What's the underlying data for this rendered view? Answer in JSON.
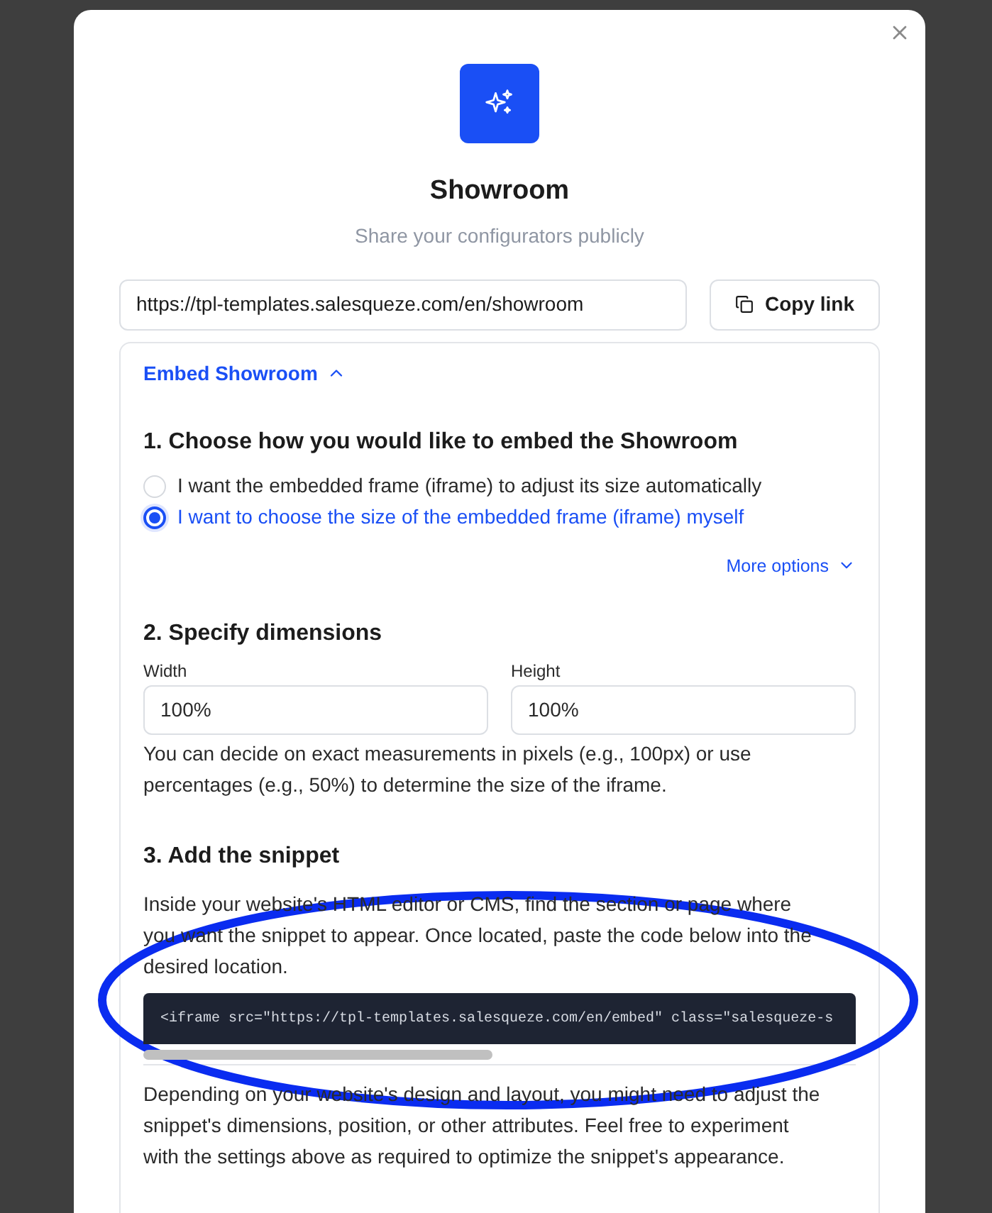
{
  "dialog": {
    "title": "Showroom",
    "subtitle": "Share your configurators publicly",
    "share": {
      "url": "https://tpl-templates.salesqueze.com/en/showroom",
      "copy_button": "Copy link"
    },
    "embed": {
      "header": "Embed Showroom",
      "expanded": true,
      "step1": {
        "heading": "1. Choose how you would like to embed the Showroom",
        "options": [
          {
            "label": "I want the embedded frame (iframe) to adjust its size automatically",
            "selected": false
          },
          {
            "label": "I want to choose the size of the embedded frame (iframe) myself",
            "selected": true
          }
        ],
        "more_options": "More options"
      },
      "step2": {
        "heading": "2. Specify dimensions",
        "fields": [
          {
            "label": "Width",
            "value": "100%"
          },
          {
            "label": "Height",
            "value": "100%"
          }
        ],
        "help": "You can decide on exact measurements in pixels (e.g., 100px) or use percentages (e.g., 50%) to determine the size of the iframe."
      },
      "step3": {
        "heading": "3. Add the snippet",
        "intro": "Inside your website's HTML editor or CMS, find the section or page where you want the snippet to appear. Once located, paste the code below into the desired location.",
        "code": "<iframe src=\"https://tpl-templates.salesqueze.com/en/embed\" class=\"salesqueze-s",
        "note": "Depending on your website's design and layout, you might need to adjust the snippet's dimensions, position, or other attributes. Feel free to experiment with the settings above as required to optimize the snippet's appearance."
      }
    }
  }
}
